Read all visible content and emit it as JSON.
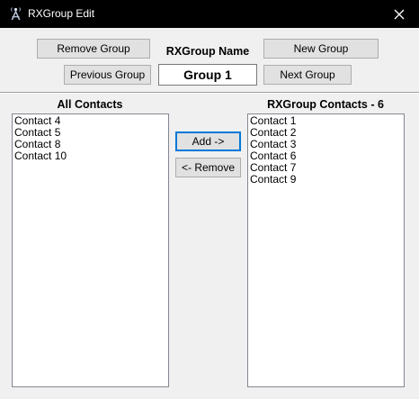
{
  "window": {
    "title": "RXGroup Edit",
    "icon": "radio-tower-icon",
    "close_icon": "close-icon"
  },
  "toolbar": {
    "remove_group_label": "Remove Group",
    "rxgroup_name_label": "RXGroup Name",
    "new_group_label": "New Group",
    "previous_group_label": "Previous Group",
    "group_name_value": "Group 1",
    "next_group_label": "Next Group"
  },
  "all_contacts": {
    "header": "All Contacts",
    "items": [
      {
        "label": "Contact 4"
      },
      {
        "label": "Contact 5"
      },
      {
        "label": "Contact 8"
      },
      {
        "label": "Contact 10"
      }
    ]
  },
  "transfer": {
    "add_label": "Add ->",
    "remove_label": "<- Remove"
  },
  "group_contacts": {
    "header": "RXGroup Contacts - 6",
    "items": [
      {
        "label": "Contact 1"
      },
      {
        "label": "Contact 2"
      },
      {
        "label": "Contact 3"
      },
      {
        "label": "Contact 6"
      },
      {
        "label": "Contact 7"
      },
      {
        "label": "Contact 9"
      }
    ]
  },
  "colors": {
    "titlebar": "#000000",
    "window_bg": "#f0f0f0",
    "focus_border": "#0078d7"
  }
}
